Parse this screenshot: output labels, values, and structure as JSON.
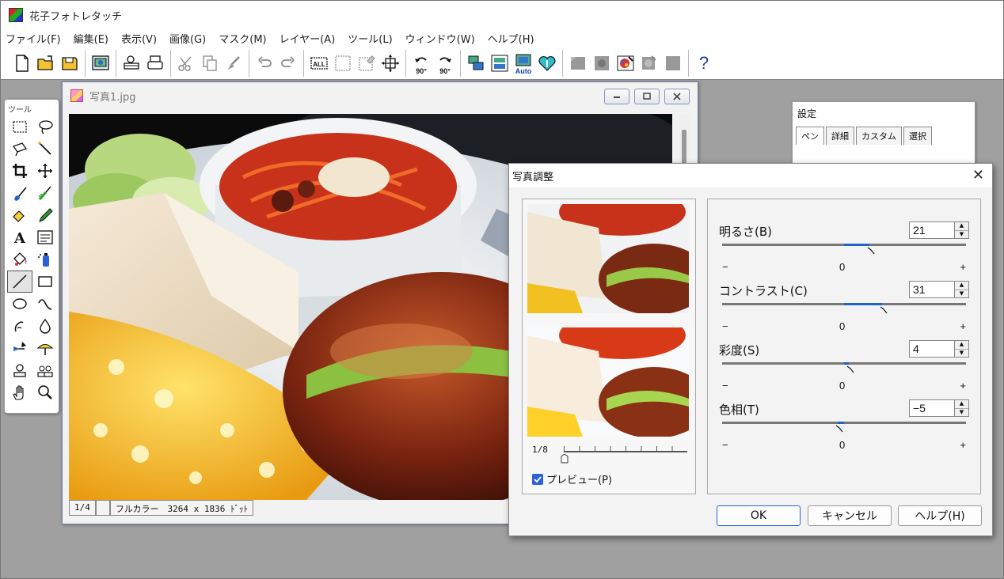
{
  "app": {
    "title": "花子フォトレタッチ",
    "menu": [
      "ファイル(F)",
      "編集(E)",
      "表示(V)",
      "画像(G)",
      "マスク(M)",
      "レイヤー(A)",
      "ツール(L)",
      "ウィンドウ(W)",
      "ヘルプ(H)"
    ]
  },
  "toolbar": {
    "all_label": "ALL",
    "rot_left_label": "90°",
    "rot_right_label": "90°",
    "auto_label": "Auto",
    "help_label": "?"
  },
  "tool_palette": {
    "title": "ツール",
    "tools": [
      "rect-select-icon",
      "lasso-icon",
      "polygon-lasso-icon",
      "magic-wand-icon",
      "crop-icon",
      "move-icon",
      "brush-icon",
      "airbrush-icon",
      "eraser-icon",
      "pencil-icon",
      "text-icon",
      "textbox-icon",
      "fill-bucket-icon",
      "spray-icon",
      "line-icon",
      "rectangle-icon",
      "ellipse-icon",
      "curve-icon",
      "smudge-icon",
      "drop-icon",
      "gradient-icon",
      "gradient-fan-icon",
      "stamp-icon",
      "clone-stamp-icon",
      "hand-icon",
      "zoom-icon"
    ],
    "selected_index": 14
  },
  "image_window": {
    "title": "写真1.jpg",
    "status": {
      "zoom": "1/4",
      "color_mode": "フルカラー　3264 x 1836 ﾄﾞｯﾄ"
    }
  },
  "settings_panel": {
    "title": "設定",
    "tabs": [
      "ペン",
      "詳細",
      "カスタム",
      "選択"
    ],
    "active_tab": 0
  },
  "dialog": {
    "title": "写真調整",
    "close_glyph": "✕",
    "preview_zoom": "1/8",
    "preview_checkbox_label": "プレビュー(P)",
    "preview_checked": true,
    "scale": {
      "min_label": "−",
      "zero_label": "0",
      "max_label": "+",
      "min": -100,
      "max": 100
    },
    "adjustments": [
      {
        "label": "明るさ(B)",
        "value": "21"
      },
      {
        "label": "コントラスト(C)",
        "value": "31"
      },
      {
        "label": "彩度(S)",
        "value": "4"
      },
      {
        "label": "色相(T)",
        "value": "−5"
      }
    ],
    "buttons": {
      "ok": "OK",
      "cancel": "キャンセル",
      "help": "ヘルプ(H)"
    }
  },
  "colors": {
    "accent": "#2a62d8",
    "slider_fill": "#1c64c8",
    "desktop": "#a0a0a0"
  }
}
